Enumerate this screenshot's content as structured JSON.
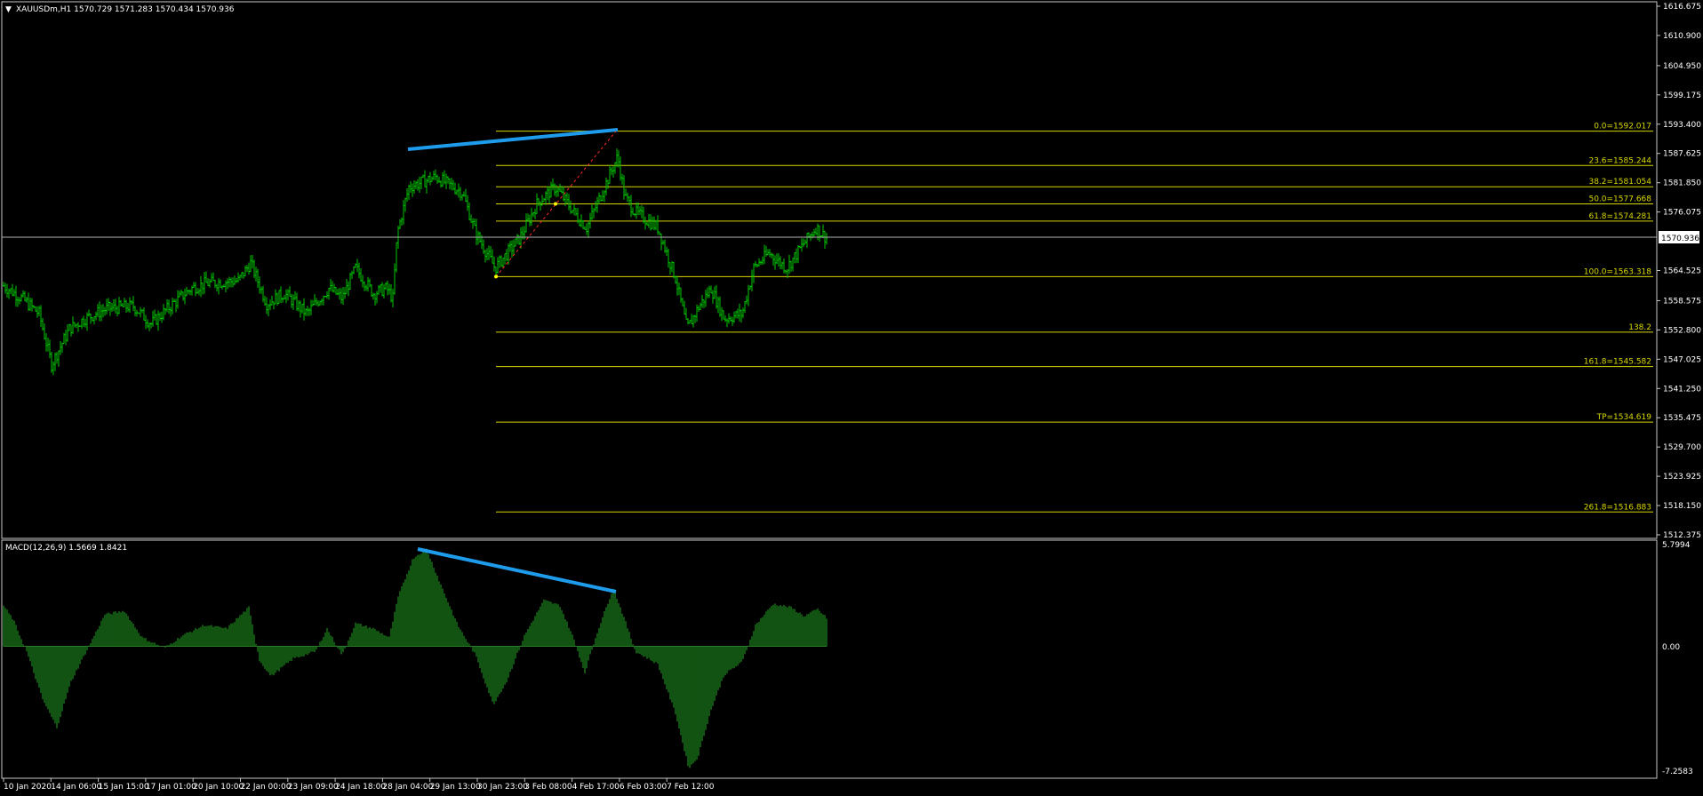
{
  "main_chart": {
    "caret": "▼",
    "header": "XAUUSDm,H1  1570.729 1571.283 1570.434 1570.936",
    "price_axis": {
      "labels": [
        "1616.675",
        "1610.900",
        "1604.950",
        "1599.175",
        "1593.400",
        "1587.625",
        "1581.850",
        "1576.075",
        "1564.525",
        "1558.575",
        "1552.800",
        "1547.025",
        "1541.250",
        "1535.475",
        "1529.700",
        "1523.925",
        "1518.150",
        "1512.375"
      ],
      "current_price": "1570.936"
    },
    "fibonacci": [
      {
        "label": "0.0=1592.017"
      },
      {
        "label": "23.6=1585.244"
      },
      {
        "label": "38.2=1581.054"
      },
      {
        "label": "50.0=1577.668"
      },
      {
        "label": "61.8=1574.281"
      },
      {
        "label": "100.0=1563.318"
      },
      {
        "label": "138.2"
      },
      {
        "label": "161.8=1545.582"
      },
      {
        "label": "TP=1534.619"
      },
      {
        "label": "261.8=1516.883"
      }
    ],
    "colors": {
      "candles": "#00c800",
      "fib": "#d7d700",
      "trendline": "#1e9bea",
      "zigzag": "#ff2a2a",
      "grid_line": "#c0c0c0"
    }
  },
  "indicator": {
    "header": "MACD(12,26,9) 1.5669 1.8421",
    "axis_labels": [
      "5.7994",
      "0.00",
      "-7.2583"
    ]
  },
  "time_axis": {
    "labels": [
      "10 Jan 2020",
      "14 Jan 06:00",
      "15 Jan 15:00",
      "17 Jan 01:00",
      "20 Jan 10:00",
      "22 Jan 00:00",
      "23 Jan 09:00",
      "24 Jan 18:00",
      "28 Jan 04:00",
      "29 Jan 13:00",
      "30 Jan 23:00",
      "3 Feb 08:00",
      "4 Feb 17:00",
      "6 Feb 03:00",
      "7 Feb 12:00"
    ]
  },
  "chart_data": [
    {
      "type": "line",
      "title": "XAUUSDm,H1",
      "x": [
        "10 Jan 2020",
        "14 Jan 06:00",
        "15 Jan 15:00",
        "17 Jan 01:00",
        "20 Jan 10:00",
        "22 Jan 00:00",
        "23 Jan 09:00",
        "24 Jan 18:00",
        "28 Jan 04:00",
        "29 Jan 13:00",
        "30 Jan 23:00",
        "3 Feb 08:00",
        "4 Feb 17:00",
        "6 Feb 03:00",
        "7 Feb 12:00"
      ],
      "series": [
        {
          "name": "XAUUSDm",
          "values": [
            1561.5,
            1546.0,
            1557.5,
            1558.0,
            1567.0,
            1558.0,
            1565.0,
            1585.0,
            1566.0,
            1580.5,
            1588.0,
            1570.0,
            1553.0,
            1565.5,
            1570.9
          ]
        }
      ],
      "ylim": [
        1512.375,
        1616.675
      ],
      "last": {
        "open": 1570.729,
        "high": 1571.283,
        "low": 1570.434,
        "close": 1570.936
      }
    },
    {
      "type": "bar",
      "title": "MACD(12,26,9)",
      "x": [
        "10 Jan 2020",
        "14 Jan 06:00",
        "15 Jan 15:00",
        "17 Jan 01:00",
        "20 Jan 10:00",
        "22 Jan 00:00",
        "23 Jan 09:00",
        "24 Jan 18:00",
        "28 Jan 04:00",
        "29 Jan 13:00",
        "30 Jan 23:00",
        "3 Feb 08:00",
        "4 Feb 17:00",
        "6 Feb 03:00",
        "7 Feb 12:00"
      ],
      "values": [
        1.5,
        -3.6,
        2.0,
        0.8,
        1.2,
        -0.6,
        0.7,
        5.6,
        -3.1,
        2.3,
        3.3,
        -0.8,
        -7.0,
        2.4,
        1.6
      ],
      "ylim": [
        -7.2583,
        5.7994
      ],
      "macd": 1.5669,
      "signal": 1.8421
    }
  ]
}
